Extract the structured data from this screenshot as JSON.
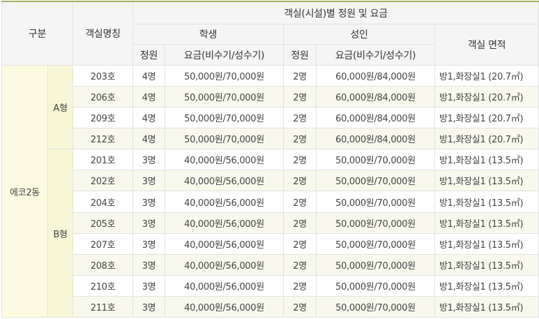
{
  "header": {
    "category": "구분",
    "room_name": "객실명칭",
    "facility_title": "객실(시설)별 정원 및 요금",
    "student": "학생",
    "adult": "성인",
    "area": "객실 면적",
    "capacity": "정원",
    "fee": "요금(비수기/성수기)"
  },
  "building": "에코2동",
  "groups": [
    {
      "type": "A형",
      "rows": [
        {
          "room": "203호",
          "s_cap": "4명",
          "s_fee": "50,000원/70,000원",
          "a_cap": "2명",
          "a_fee": "60,000원/84,000원",
          "area": "방1,화장실1 (20.7㎡)"
        },
        {
          "room": "206호",
          "s_cap": "4명",
          "s_fee": "50,000원/70,000원",
          "a_cap": "2명",
          "a_fee": "60,000원/84,000원",
          "area": "방1,화장실1 (20.7㎡)"
        },
        {
          "room": "209호",
          "s_cap": "4명",
          "s_fee": "50,000원/70,000원",
          "a_cap": "2명",
          "a_fee": "60,000원/84,000원",
          "area": "방1,화장실1 (20.7㎡)"
        },
        {
          "room": "212호",
          "s_cap": "4명",
          "s_fee": "50,000원/70,000원",
          "a_cap": "2명",
          "a_fee": "60,000원/84,000원",
          "area": "방1,화장실1 (20.7㎡)"
        }
      ]
    },
    {
      "type": "B형",
      "rows": [
        {
          "room": "201호",
          "s_cap": "3명",
          "s_fee": "40,000원/56,000원",
          "a_cap": "2명",
          "a_fee": "50,000원/70,000원",
          "area": "방1,화장실1 (13.5㎡)"
        },
        {
          "room": "202호",
          "s_cap": "3명",
          "s_fee": "40,000원/56,000원",
          "a_cap": "2명",
          "a_fee": "50,000원/70,000원",
          "area": "방1,화장실1 (13.5㎡)"
        },
        {
          "room": "204호",
          "s_cap": "3명",
          "s_fee": "40,000원/56,000원",
          "a_cap": "2명",
          "a_fee": "50,000원/70,000원",
          "area": "방1,화장실1 (13.5㎡)"
        },
        {
          "room": "205호",
          "s_cap": "3명",
          "s_fee": "40,000원/56,000원",
          "a_cap": "2명",
          "a_fee": "50,000원/70,000원",
          "area": "방1,화장실1 (13.5㎡)"
        },
        {
          "room": "207호",
          "s_cap": "3명",
          "s_fee": "40,000원/56,000원",
          "a_cap": "2명",
          "a_fee": "50,000원/70,000원",
          "area": "방1,화장실1 (13.5㎡)"
        },
        {
          "room": "208호",
          "s_cap": "3명",
          "s_fee": "40,000원/56,000원",
          "a_cap": "2명",
          "a_fee": "50,000원/70,000원",
          "area": "방1,화장실1 (13.5㎡)"
        },
        {
          "room": "210호",
          "s_cap": "3명",
          "s_fee": "40,000원/56,000원",
          "a_cap": "2명",
          "a_fee": "50,000원/70,000원",
          "area": "방1,화장실1 (13.5㎡)"
        },
        {
          "room": "211호",
          "s_cap": "3명",
          "s_fee": "40,000원/56,000원",
          "a_cap": "2명",
          "a_fee": "50,000원/70,000원",
          "area": "방1,화장실1 (13.5㎡)"
        }
      ]
    }
  ],
  "colors": {
    "header_bg": "#f5f5f5",
    "header_top_border": "#a4ae5e",
    "building_bg": "#fcfbe0",
    "type_bg": "#f7f7d6",
    "alt_row_bg": "#f8f8ec",
    "border": "#e2e2e2"
  }
}
